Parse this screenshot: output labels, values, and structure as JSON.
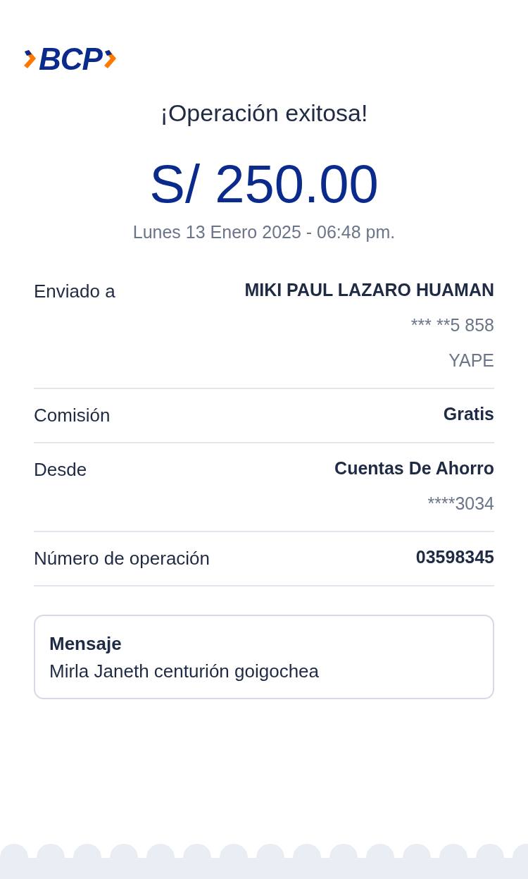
{
  "logo": {
    "text": "BCP"
  },
  "title": "¡Operación exitosa!",
  "amount": "S/ 250.00",
  "datetime": "Lunes 13 Enero 2025 - 06:48 pm.",
  "details": [
    {
      "label": "Enviado a",
      "values": [
        {
          "text": "MIKI PAUL LAZARO HUAMAN",
          "kind": "strong"
        },
        {
          "text": "*** **5 858",
          "kind": "muted"
        },
        {
          "text": "YAPE",
          "kind": "muted"
        }
      ]
    },
    {
      "label": "Comisión",
      "values": [
        {
          "text": "Gratis",
          "kind": "strong"
        }
      ]
    },
    {
      "label": "Desde",
      "values": [
        {
          "text": "Cuentas De Ahorro",
          "kind": "strong"
        },
        {
          "text": "****3034",
          "kind": "muted"
        }
      ]
    },
    {
      "label": "Número de operación",
      "values": [
        {
          "text": "03598345",
          "kind": "strong"
        }
      ]
    }
  ],
  "message": {
    "title": "Mensaje",
    "text": "Mirla Janeth centurión goigochea"
  }
}
